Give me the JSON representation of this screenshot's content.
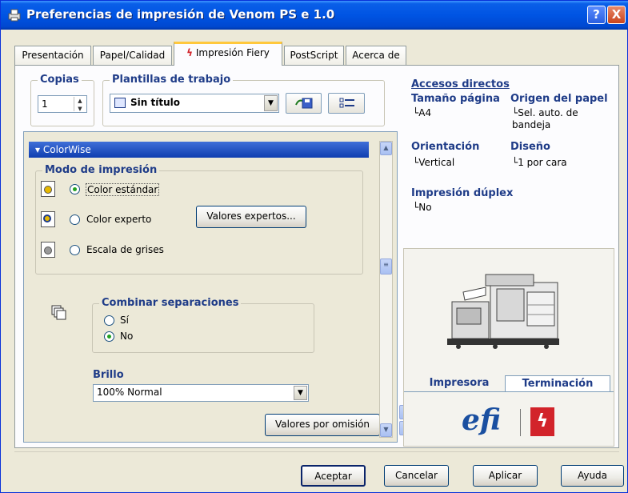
{
  "window": {
    "title": "Preferencias de impresión de Venom PS e 1.0",
    "help_glyph": "?",
    "close_glyph": "X"
  },
  "tabs": [
    {
      "label": "Presentación"
    },
    {
      "label": "Papel/Calidad"
    },
    {
      "label": "Impresión Fiery"
    },
    {
      "label": "PostScript"
    },
    {
      "label": "Acerca de"
    }
  ],
  "copies": {
    "label": "Copias",
    "value": "1"
  },
  "templates": {
    "label": "Plantillas de trabajo",
    "value": "Sin título"
  },
  "shortcuts": {
    "title": "Accesos directos",
    "paper_size_label": "Tamaño página",
    "paper_size_value": "A4",
    "paper_source_label": "Origen del papel",
    "paper_source_value": "Sel. auto. de bandeja",
    "orientation_label": "Orientación",
    "orientation_value": "Vertical",
    "layout_label": "Diseño",
    "layout_value": "1 por cara",
    "duplex_label": "Impresión dúplex",
    "duplex_value": "No"
  },
  "colorwise": {
    "header": "ColorWise",
    "print_mode_label": "Modo de impresión",
    "standard_color": "Color estándar",
    "expert_color": "Color experto",
    "grayscale": "Escala de grises",
    "expert_settings_button": "Valores expertos...",
    "combine_separations_label": "Combinar separaciones",
    "yes": "Sí",
    "no": "No",
    "brightness_label": "Brillo",
    "brightness_value": "100% Normal",
    "defaults_button": "Valores por omisión"
  },
  "printer_panel": {
    "printer_tab": "Impresora",
    "finishing_tab": "Terminación"
  },
  "buttons": {
    "ok": "Aceptar",
    "cancel": "Cancelar",
    "apply": "Aplicar",
    "help": "Ayuda"
  },
  "colors": {
    "titlebar": "#0054e3",
    "accent": "#1f3c88",
    "efi_blue": "#1a4fa0",
    "fiery_red": "#d2232a"
  }
}
